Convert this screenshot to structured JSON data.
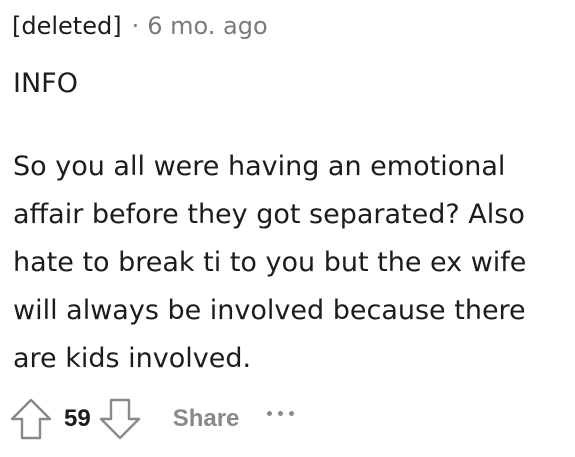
{
  "comment": {
    "author": "[deleted]",
    "separator": "·",
    "timestamp": "6 mo. ago",
    "paragraphs": [
      "INFO",
      "So you all were having an emotional affair before they got separated? Also hate to break ti to you but the ex wife will always be involved because there are kids involved."
    ],
    "body_lines": [
      "So you all were having an emotional",
      "affair before they got separated? Also",
      "hate to break ti to you but the ex wife",
      "will always be involved because there",
      "are kids involved."
    ]
  },
  "actions": {
    "score": "59",
    "share_label": "Share",
    "upvote_icon": "arrow-up-icon",
    "downvote_icon": "arrow-down-icon",
    "more_icon": "ellipsis-icon"
  },
  "colors": {
    "text": "#1c1c1c",
    "meta": "#787c7e",
    "icon": "#878a8c"
  }
}
